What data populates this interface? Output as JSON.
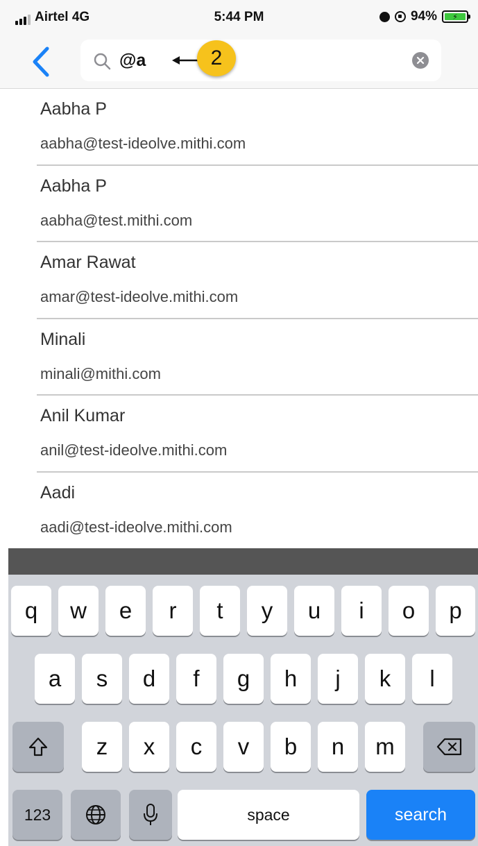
{
  "status_bar": {
    "carrier": "Airtel 4G",
    "time": "5:44 PM",
    "battery": "94%",
    "icons": [
      "signal-icon",
      "alarm-icon",
      "rotation-lock-icon",
      "battery-icon"
    ]
  },
  "search": {
    "query": "@a",
    "annotation_number": "2"
  },
  "results": [
    {
      "name": "Aabha P",
      "email": "aabha@test-ideolve.mithi.com"
    },
    {
      "name": "Aabha P",
      "email": "aabha@test.mithi.com"
    },
    {
      "name": "Amar Rawat",
      "email": "amar@test-ideolve.mithi.com"
    },
    {
      "name": "Minali",
      "email": "minali@mithi.com"
    },
    {
      "name": "Anil Kumar",
      "email": "anil@test-ideolve.mithi.com"
    },
    {
      "name": "Aadi",
      "email": "aadi@test-ideolve.mithi.com"
    }
  ],
  "keyboard": {
    "row1": [
      "q",
      "w",
      "e",
      "r",
      "t",
      "y",
      "u",
      "i",
      "o",
      "p"
    ],
    "row2": [
      "a",
      "s",
      "d",
      "f",
      "g",
      "h",
      "j",
      "k",
      "l"
    ],
    "row3": [
      "z",
      "x",
      "c",
      "v",
      "b",
      "n",
      "m"
    ],
    "numbers_label": "123",
    "space_label": "space",
    "search_label": "search"
  },
  "colors": {
    "accent_blue": "#1a82f7",
    "annotation_yellow": "#f6c21c",
    "keyboard_bg": "#d1d4da"
  }
}
